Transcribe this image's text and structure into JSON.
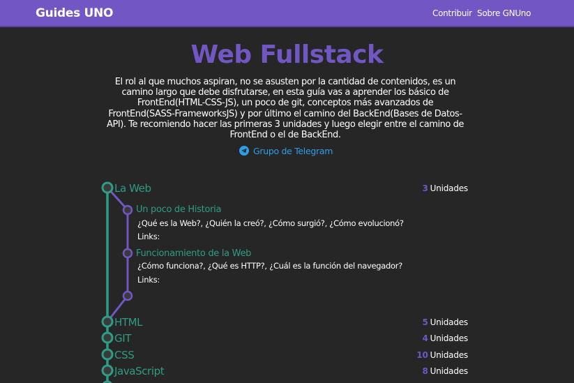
{
  "navbar": {
    "brand": "Guides UNO",
    "links": [
      "Contribuir",
      "Sobre GNUno"
    ]
  },
  "page": {
    "title": "Web Fullstack",
    "intro": "El rol al que muchos aspiran, no se asusten por la cantidad de contenidos, es un camino largo que debe disfrutarse, en esta guía vas a aprender los básico de FrontEnd(HTML-CSS-JS), un poco de git, conceptos más avanzados de FrontEnd(SASS-FrameworksJS) y por último el camino del BackEnd(Bases de Datos-API). Te recomiendo hacer las primeras 3 unidades y luego elegir entre el camino de FrontEnd o el de BackEnd.",
    "telegram": {
      "label": "Grupo de Telegram",
      "icon": "telegram-icon"
    }
  },
  "roadmap": {
    "units_suffix": "Unidades",
    "units": [
      {
        "title": "La Web",
        "count": "3"
      },
      {
        "title": "HTML",
        "count": "5"
      },
      {
        "title": "GIT",
        "count": "4"
      },
      {
        "title": "CSS",
        "count": "10"
      },
      {
        "title": "JavaScript",
        "count": "8"
      }
    ],
    "lessons": [
      {
        "title": "Un poco de Historia",
        "description": "¿Qué es la Web?, ¿Quién la creó?, ¿Cómo surgió?, ¿Cómo evolucionó?",
        "links_label": "Links:"
      },
      {
        "title": "Funcionamiento de la Web",
        "description": "¿Cómo funciona?, ¿Qué es HTTP?, ¿Cuál es la función del navegador?",
        "links_label": "Links:"
      }
    ]
  },
  "colors": {
    "navbar": "#7257c4",
    "background": "#262626",
    "accent_purple": "#7257c4",
    "accent_teal": "#2f9c86",
    "link_blue": "#2d9ee8"
  }
}
